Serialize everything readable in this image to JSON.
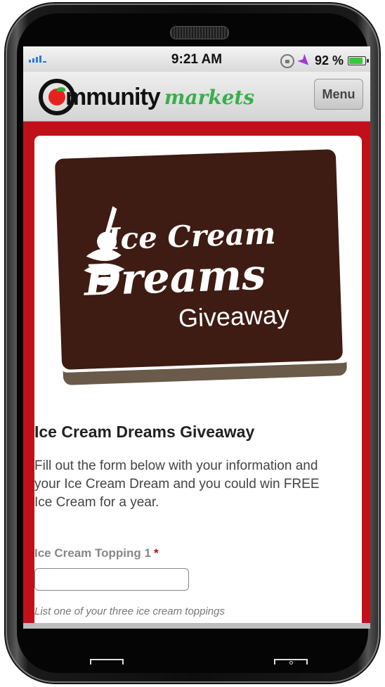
{
  "status_bar": {
    "time": "9:21 AM",
    "battery_percent": "92 %",
    "battery_level": 0.92
  },
  "header": {
    "logo_word": "mmunity",
    "logo_script": "markets",
    "menu_label": "Menu"
  },
  "banner": {
    "line1": "Ice Cream",
    "line2": "Dreams",
    "line3": "Giveaway"
  },
  "form": {
    "title": "Ice Cream Dreams Giveaway",
    "description": "Fill out the form below with your information and your Ice Cream Dream and you could win FREE Ice Cream for a year.",
    "field_label": "Ice Cream Topping 1",
    "required_mark": "*",
    "field_value": "",
    "field_hint": "List one of your three ice cream toppings"
  },
  "colors": {
    "brand_red": "#c0111a",
    "brand_green": "#37b04a",
    "banner_brown": "#3e1c13"
  }
}
